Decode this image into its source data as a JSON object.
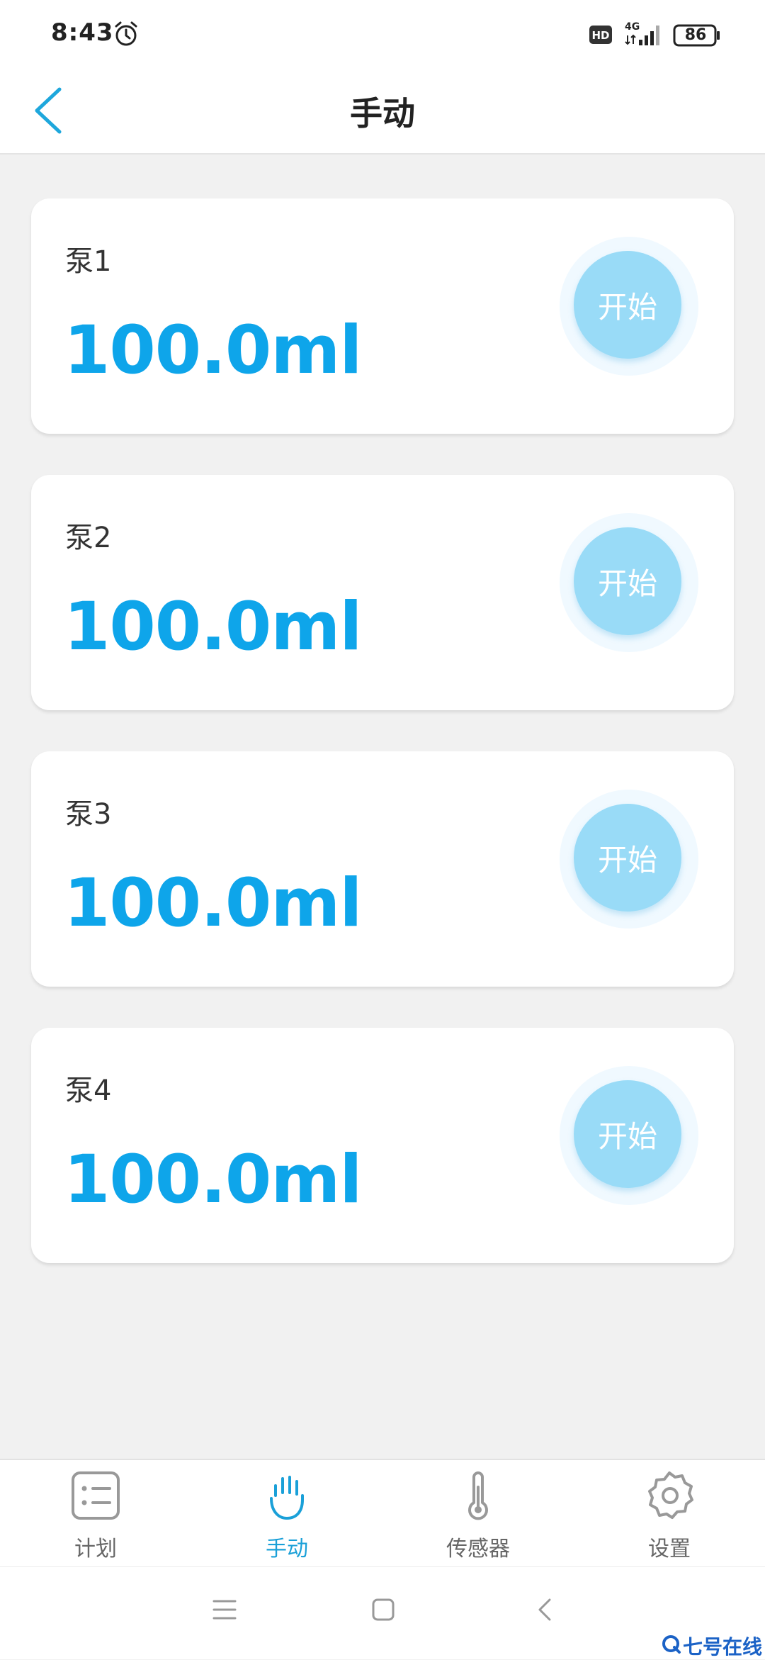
{
  "status_bar": {
    "time": "8:43",
    "network": "4G",
    "battery": "86",
    "icons": [
      "alarm-icon",
      "hd-icon",
      "signal-icon",
      "battery-icon"
    ]
  },
  "header": {
    "title": "手动",
    "back_icon": "chevron-left-icon"
  },
  "pumps": [
    {
      "name": "泵1",
      "volume": "100.0ml",
      "start_label": "开始"
    },
    {
      "name": "泵2",
      "volume": "100.0ml",
      "start_label": "开始"
    },
    {
      "name": "泵3",
      "volume": "100.0ml",
      "start_label": "开始"
    },
    {
      "name": "泵4",
      "volume": "100.0ml",
      "start_label": "开始"
    }
  ],
  "bottom_nav": {
    "items": [
      {
        "label": "计划",
        "icon": "list-icon",
        "active": false
      },
      {
        "label": "手动",
        "icon": "hand-icon",
        "active": true
      },
      {
        "label": "传感器",
        "icon": "thermometer-icon",
        "active": false
      },
      {
        "label": "设置",
        "icon": "gear-icon",
        "active": false
      }
    ]
  },
  "system_nav": {
    "icons": [
      "menu-icon",
      "home-icon",
      "back-icon"
    ]
  },
  "watermark": "七号在线",
  "colors": {
    "accent": "#0ea5ea",
    "start_button": "#99dbf7",
    "nav_active": "#1aa0d8",
    "background": "#f1f1f1"
  }
}
